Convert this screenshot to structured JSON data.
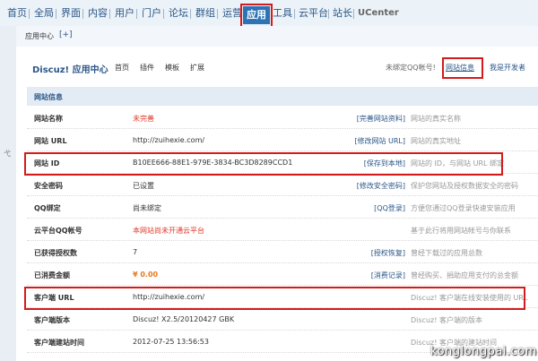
{
  "nav": {
    "items": [
      "首页",
      "全局",
      "界面",
      "内容",
      "用户",
      "门户",
      "论坛",
      "群组",
      "运营",
      "应用",
      "工具",
      "云平台",
      "站长",
      "UCenter"
    ]
  },
  "subbar": {
    "label": "应用中心",
    "plus": "[+]"
  },
  "gutter": {
    "char": "弋"
  },
  "header": {
    "brand": "Discuz! 应用中心",
    "tabs": [
      "首页",
      "插件",
      "模板",
      "扩展"
    ],
    "unbound_text": "未绑定QQ帐号!",
    "site_info_link": "网站信息",
    "developer_link": "我是开发者"
  },
  "section_title": "网站信息",
  "rows": [
    {
      "key": "网站名称",
      "value": "未完善",
      "action": "[完善网站资料]",
      "desc": "网站的真实名称"
    },
    {
      "key": "网站 URL",
      "value": "http://zuihexie.com/",
      "action": "[修改网站 URL]",
      "desc": "网站的真实地址"
    },
    {
      "key": "网站 ID",
      "value": "B10EE666-88E1-979E-3834-BC3D8289CCD1",
      "action": "[保存到本地]",
      "desc": "网站的 ID，与网站 URL 绑定"
    },
    {
      "key": "安全密码",
      "value": "已设置",
      "action": "[修改安全密码]",
      "desc": "保护您网站及授权数据安全的密码"
    },
    {
      "key": "QQ绑定",
      "value": "尚未绑定",
      "action": "[QQ登录]",
      "desc": "方便您通过QQ登录快速安装应用"
    },
    {
      "key": "云平台QQ帐号",
      "value": "本网站尚未开通云平台",
      "action": "",
      "desc": "基于此行将用网站帐号与你联系"
    },
    {
      "key": "已获得授权数",
      "value": "7",
      "action": "[授权恢复]",
      "desc": "曾经下载过的应用总数"
    },
    {
      "key": "已消费金额",
      "value": "¥ 0.00",
      "action": "[消费记录]",
      "desc": "曾经购买、捐助应用支付的总金额"
    },
    {
      "key": "客户端 URL",
      "value": "http://zuihexie.com/",
      "action": "",
      "desc": "Discuz! 客户端在线安装使用的 URL"
    },
    {
      "key": "客户端版本",
      "value": "Discuz! X2.5/20120427 GBK",
      "action": "",
      "desc": "Discuz! 客户端的版本"
    },
    {
      "key": "客户端建站时间",
      "value": "2012-07-25 13:56:53",
      "action": "",
      "desc": "Discuz! 客户端的建站时间"
    }
  ],
  "watermark": "konglongpai.com"
}
